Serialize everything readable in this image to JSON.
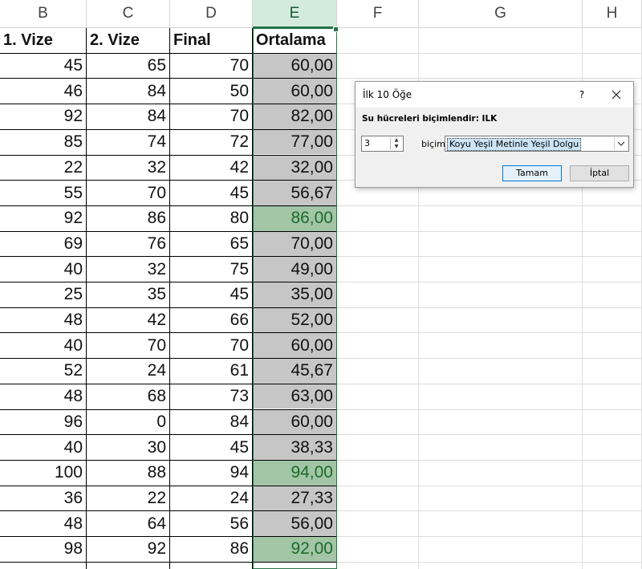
{
  "columns": [
    "B",
    "C",
    "D",
    "E",
    "F",
    "G",
    "H"
  ],
  "selected_column": "E",
  "headers": {
    "b": "1. Vize",
    "c": "2. Vize",
    "d": "Final",
    "e": "Ortalama"
  },
  "rows": [
    {
      "b": "45",
      "c": "65",
      "d": "70",
      "e": "60,00",
      "top": false
    },
    {
      "b": "46",
      "c": "84",
      "d": "50",
      "e": "60,00",
      "top": false
    },
    {
      "b": "92",
      "c": "84",
      "d": "70",
      "e": "82,00",
      "top": false
    },
    {
      "b": "85",
      "c": "74",
      "d": "72",
      "e": "77,00",
      "top": false
    },
    {
      "b": "22",
      "c": "32",
      "d": "42",
      "e": "32,00",
      "top": false
    },
    {
      "b": "55",
      "c": "70",
      "d": "45",
      "e": "56,67",
      "top": false
    },
    {
      "b": "92",
      "c": "86",
      "d": "80",
      "e": "86,00",
      "top": true
    },
    {
      "b": "69",
      "c": "76",
      "d": "65",
      "e": "70,00",
      "top": false
    },
    {
      "b": "40",
      "c": "32",
      "d": "75",
      "e": "49,00",
      "top": false
    },
    {
      "b": "25",
      "c": "35",
      "d": "45",
      "e": "35,00",
      "top": false
    },
    {
      "b": "48",
      "c": "42",
      "d": "66",
      "e": "52,00",
      "top": false
    },
    {
      "b": "40",
      "c": "70",
      "d": "70",
      "e": "60,00",
      "top": false
    },
    {
      "b": "52",
      "c": "24",
      "d": "61",
      "e": "45,67",
      "top": false
    },
    {
      "b": "48",
      "c": "68",
      "d": "73",
      "e": "63,00",
      "top": false
    },
    {
      "b": "96",
      "c": "0",
      "d": "84",
      "e": "60,00",
      "top": false
    },
    {
      "b": "40",
      "c": "30",
      "d": "45",
      "e": "38,33",
      "top": false
    },
    {
      "b": "100",
      "c": "88",
      "d": "94",
      "e": "94,00",
      "top": true
    },
    {
      "b": "36",
      "c": "22",
      "d": "24",
      "e": "27,33",
      "top": false
    },
    {
      "b": "48",
      "c": "64",
      "d": "56",
      "e": "56,00",
      "top": false
    },
    {
      "b": "98",
      "c": "92",
      "d": "86",
      "e": "92,00",
      "top": true
    }
  ],
  "dialog": {
    "title": "İlk 10 Öğe",
    "help": "?",
    "prompt": "Su hücreleri biçimlendir: ILK",
    "count": "3",
    "with_label": "biçim:",
    "format": "Koyu Yeşil Metinle Yeşil Dolgu",
    "ok": "Tamam",
    "cancel": "İptal"
  },
  "colors": {
    "accent": "#217346",
    "top_fill": "#a2c5a6",
    "top_text": "#1c6b2b",
    "column_fill": "#c6c6c6"
  }
}
